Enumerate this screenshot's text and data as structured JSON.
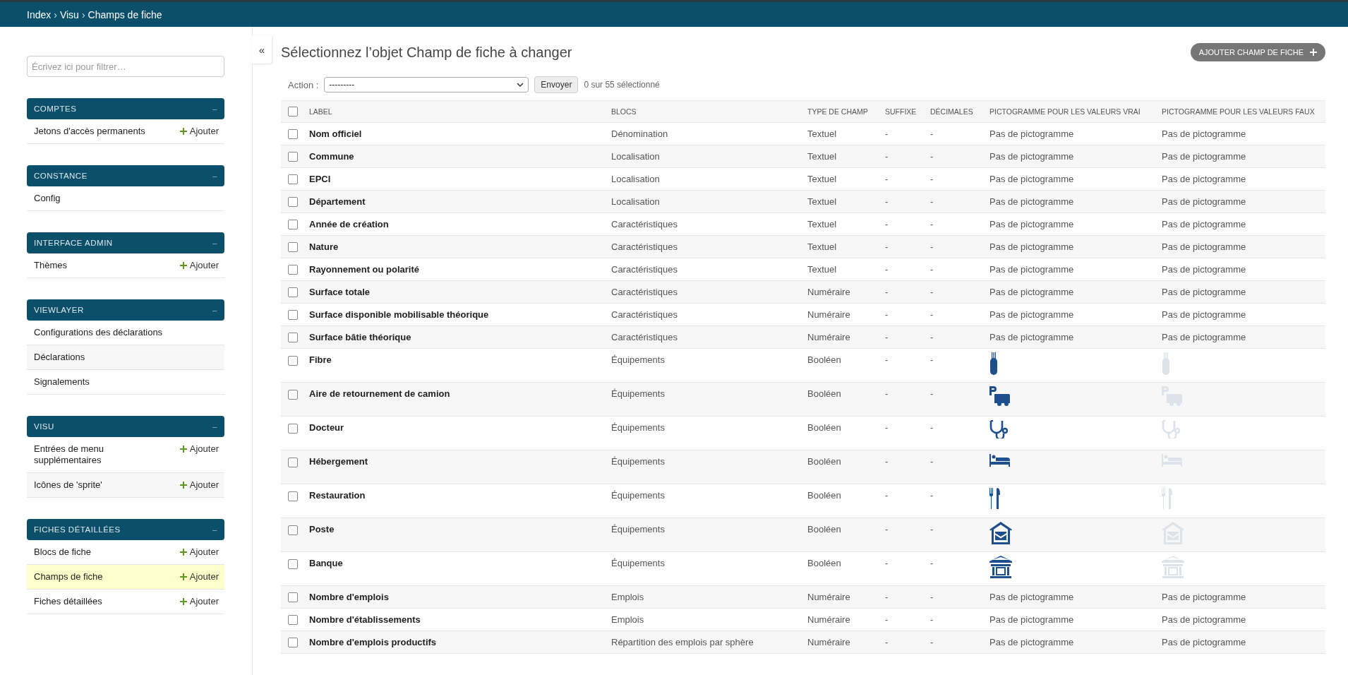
{
  "breadcrumbs": [
    "Index",
    "Visu",
    "Champs de fiche"
  ],
  "breadcrumb_separator": "›",
  "sidebar": {
    "filter_placeholder": "Écrivez ici pour filtrer…",
    "collapse_toggle": "«",
    "modules": [
      {
        "title": "COMPTES",
        "collapse": "–",
        "items": [
          {
            "label": "Jetons d'accès permanents",
            "add": "Ajouter",
            "selected": false
          }
        ]
      },
      {
        "title": "CONSTANCE",
        "collapse": "–",
        "items": [
          {
            "label": "Config",
            "selected": false
          }
        ]
      },
      {
        "title": "INTERFACE ADMIN",
        "collapse": "–",
        "items": [
          {
            "label": "Thèmes",
            "add": "Ajouter",
            "selected": false
          }
        ]
      },
      {
        "title": "VIEWLAYER",
        "collapse": "–",
        "items": [
          {
            "label": "Configurations des déclarations",
            "selected": false
          },
          {
            "label": "Déclarations",
            "selected": false
          },
          {
            "label": "Signalements",
            "selected": false
          }
        ]
      },
      {
        "title": "VISU",
        "collapse": "–",
        "items": [
          {
            "label": "Entrées de menu supplémentaires",
            "add": "Ajouter",
            "selected": false
          },
          {
            "label": "Icônes de 'sprite'",
            "add": "Ajouter",
            "selected": false
          }
        ]
      },
      {
        "title": "FICHES DÉTAILLÉES",
        "collapse": "–",
        "items": [
          {
            "label": "Blocs de fiche",
            "add": "Ajouter",
            "selected": false
          },
          {
            "label": "Champs de fiche",
            "add": "Ajouter",
            "selected": true
          },
          {
            "label": "Fiches détaillées",
            "add": "Ajouter",
            "selected": false
          }
        ]
      }
    ]
  },
  "page_title": "Sélectionnez l’objet Champ de fiche à changer",
  "add_button": "AJOUTER CHAMP DE FICHE",
  "actions": {
    "label": "Action :",
    "select_value": "---------",
    "submit": "Envoyer",
    "counter": "0 sur 55 sélectionné"
  },
  "table": {
    "select_all_checked": false,
    "columns": [
      "LABEL",
      "BLOCS",
      "TYPE DE CHAMP",
      "SUFFIXE",
      "DÉCIMALES",
      "PICTOGRAMME POUR LES VALEURS VRAI",
      "PICTOGRAMME POUR LES VALEURS FAUX"
    ],
    "rows": [
      {
        "checked": false,
        "label": "Nom officiel",
        "bloc": "Dénomination",
        "type": "Textuel",
        "suffix": "-",
        "decimals": "-",
        "picto": {
          "kind": "text",
          "text_true": "Pas de pictogramme",
          "text_false": "Pas de pictogramme"
        }
      },
      {
        "checked": false,
        "label": "Commune",
        "bloc": "Localisation",
        "type": "Textuel",
        "suffix": "-",
        "decimals": "-",
        "picto": {
          "kind": "text",
          "text_true": "Pas de pictogramme",
          "text_false": "Pas de pictogramme"
        }
      },
      {
        "checked": false,
        "label": "EPCI",
        "bloc": "Localisation",
        "type": "Textuel",
        "suffix": "-",
        "decimals": "-",
        "picto": {
          "kind": "text",
          "text_true": "Pas de pictogramme",
          "text_false": "Pas de pictogramme"
        }
      },
      {
        "checked": false,
        "label": "Département",
        "bloc": "Localisation",
        "type": "Textuel",
        "suffix": "-",
        "decimals": "-",
        "picto": {
          "kind": "text",
          "text_true": "Pas de pictogramme",
          "text_false": "Pas de pictogramme"
        }
      },
      {
        "checked": false,
        "label": "Année de création",
        "bloc": "Caractéristiques",
        "type": "Textuel",
        "suffix": "-",
        "decimals": "-",
        "picto": {
          "kind": "text",
          "text_true": "Pas de pictogramme",
          "text_false": "Pas de pictogramme"
        }
      },
      {
        "checked": false,
        "label": "Nature",
        "bloc": "Caractéristiques",
        "type": "Textuel",
        "suffix": "-",
        "decimals": "-",
        "picto": {
          "kind": "text",
          "text_true": "Pas de pictogramme",
          "text_false": "Pas de pictogramme"
        }
      },
      {
        "checked": false,
        "label": "Rayonnement ou polarité",
        "bloc": "Caractéristiques",
        "type": "Textuel",
        "suffix": "-",
        "decimals": "-",
        "picto": {
          "kind": "text",
          "text_true": "Pas de pictogramme",
          "text_false": "Pas de pictogramme"
        }
      },
      {
        "checked": false,
        "label": "Surface totale",
        "bloc": "Caractéristiques",
        "type": "Numéraire",
        "suffix": "-",
        "decimals": "-",
        "picto": {
          "kind": "text",
          "text_true": "Pas de pictogramme",
          "text_false": "Pas de pictogramme"
        }
      },
      {
        "checked": false,
        "label": "Surface disponible mobilisable théorique",
        "bloc": "Caractéristiques",
        "type": "Numéraire",
        "suffix": "-",
        "decimals": "-",
        "picto": {
          "kind": "text",
          "text_true": "Pas de pictogramme",
          "text_false": "Pas de pictogramme"
        }
      },
      {
        "checked": false,
        "label": "Surface bâtie théorique",
        "bloc": "Caractéristiques",
        "type": "Numéraire",
        "suffix": "-",
        "decimals": "-",
        "picto": {
          "kind": "text",
          "text_true": "Pas de pictogramme",
          "text_false": "Pas de pictogramme"
        }
      },
      {
        "checked": false,
        "label": "Fibre",
        "bloc": "Équipements",
        "type": "Booléen",
        "suffix": "-",
        "decimals": "-",
        "picto": {
          "kind": "cable"
        }
      },
      {
        "checked": false,
        "label": "Aire de retournement de camion",
        "bloc": "Équipements",
        "type": "Booléen",
        "suffix": "-",
        "decimals": "-",
        "picto": {
          "kind": "truck"
        }
      },
      {
        "checked": false,
        "label": "Docteur",
        "bloc": "Équipements",
        "type": "Booléen",
        "suffix": "-",
        "decimals": "-",
        "picto": {
          "kind": "stethoscope"
        }
      },
      {
        "checked": false,
        "label": "Hébergement",
        "bloc": "Équipements",
        "type": "Booléen",
        "suffix": "-",
        "decimals": "-",
        "picto": {
          "kind": "bed"
        }
      },
      {
        "checked": false,
        "label": "Restauration",
        "bloc": "Équipements",
        "type": "Booléen",
        "suffix": "-",
        "decimals": "-",
        "picto": {
          "kind": "cutlery"
        }
      },
      {
        "checked": false,
        "label": "Poste",
        "bloc": "Équipements",
        "type": "Booléen",
        "suffix": "-",
        "decimals": "-",
        "picto": {
          "kind": "mail"
        }
      },
      {
        "checked": false,
        "label": "Banque",
        "bloc": "Équipements",
        "type": "Booléen",
        "suffix": "-",
        "decimals": "-",
        "picto": {
          "kind": "bank"
        }
      },
      {
        "checked": false,
        "label": "Nombre d'emplois",
        "bloc": "Emplois",
        "type": "Numéraire",
        "suffix": "-",
        "decimals": "-",
        "picto": {
          "kind": "text",
          "text_true": "Pas de pictogramme",
          "text_false": "Pas de pictogramme"
        }
      },
      {
        "checked": false,
        "label": "Nombre d'établissements",
        "bloc": "Emplois",
        "type": "Numéraire",
        "suffix": "-",
        "decimals": "-",
        "picto": {
          "kind": "text",
          "text_true": "Pas de pictogramme",
          "text_false": "Pas de pictogramme"
        }
      },
      {
        "checked": false,
        "label": "Nombre d'emplois productifs",
        "bloc": "Répartition des emplois par sphère",
        "type": "Numéraire",
        "suffix": "-",
        "decimals": "-",
        "picto": {
          "kind": "text",
          "text_true": "Pas de pictogramme",
          "text_false": "Pas de pictogramme"
        }
      }
    ]
  }
}
